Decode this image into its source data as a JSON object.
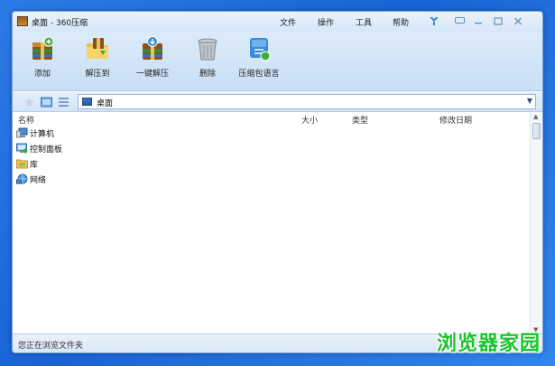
{
  "window": {
    "title": "桌面 - 360压缩"
  },
  "menu": {
    "items": [
      "文件",
      "操作",
      "工具",
      "帮助"
    ]
  },
  "toolbar": {
    "tools": [
      {
        "label": "添加",
        "icon": "add-archive-icon"
      },
      {
        "label": "解压到",
        "icon": "extract-to-icon"
      },
      {
        "label": "一键解压",
        "icon": "one-click-extract-icon"
      },
      {
        "label": "删除",
        "icon": "trash-icon"
      },
      {
        "label": "压缩包语言",
        "icon": "archive-language-icon"
      }
    ]
  },
  "address": {
    "value": "桌面"
  },
  "columns": {
    "name": "名称",
    "size": "大小",
    "type": "类型",
    "modified": "修改日期"
  },
  "items": [
    {
      "name": "计算机",
      "icon": "computer-icon"
    },
    {
      "name": "控制面板",
      "icon": "control-panel-icon"
    },
    {
      "name": "库",
      "icon": "library-folder-icon"
    },
    {
      "name": "网络",
      "icon": "network-icon"
    }
  ],
  "status": {
    "text": "您正在浏览文件夹"
  },
  "watermark": {
    "text": "浏览器家园"
  }
}
